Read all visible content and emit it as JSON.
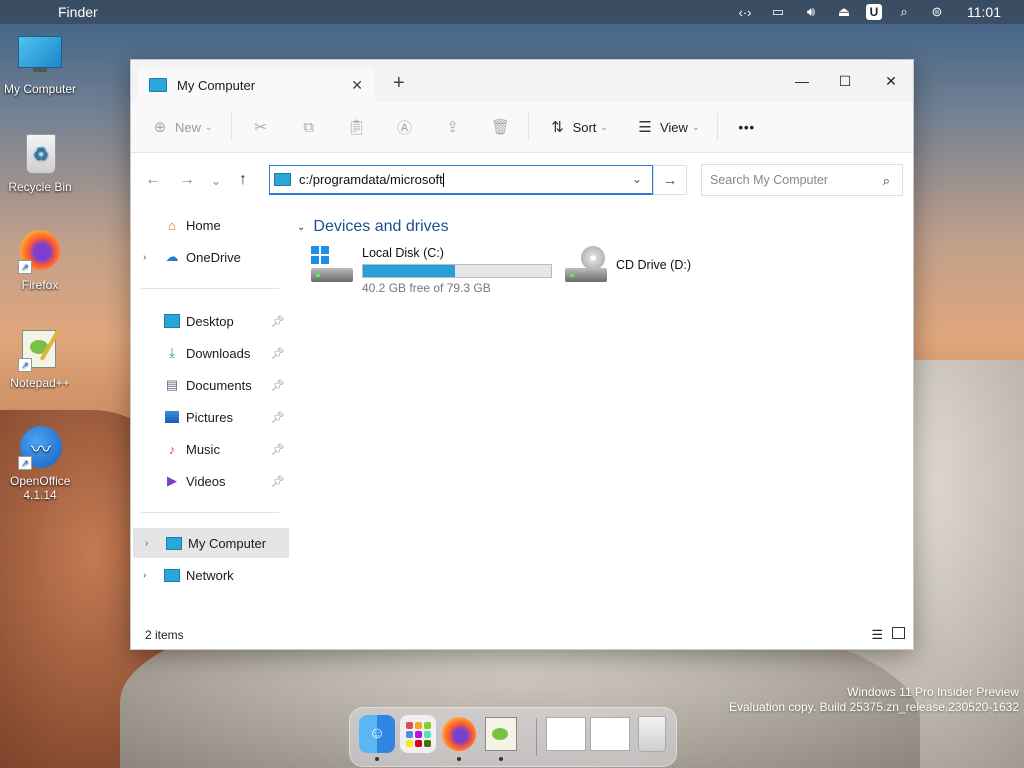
{
  "menubar": {
    "app_name": "Finder",
    "clock": "11:01",
    "user_badge": "U"
  },
  "desktop_icons": [
    {
      "label": "My Computer"
    },
    {
      "label": "Recycle Bin"
    },
    {
      "label": "Firefox"
    },
    {
      "label": "Notepad++"
    },
    {
      "label": "OpenOffice 4.1.14"
    }
  ],
  "window": {
    "tab_title": "My Computer",
    "toolbar": {
      "new": "New",
      "sort": "Sort",
      "view": "View",
      "more": "•••"
    },
    "address": "c:/programdata/microsoft",
    "search_placeholder": "Search My Computer",
    "sidebar": {
      "home": "Home",
      "onedrive": "OneDrive",
      "desktop": "Desktop",
      "downloads": "Downloads",
      "documents": "Documents",
      "pictures": "Pictures",
      "music": "Music",
      "videos": "Videos",
      "my_computer": "My Computer",
      "network": "Network"
    },
    "group_title": "Devices and drives",
    "drives": [
      {
        "name": "Local Disk (C:)",
        "free_text": "40.2 GB free of 79.3 GB",
        "used_fraction": 0.49
      },
      {
        "name": "CD Drive (D:)"
      }
    ],
    "status": {
      "count": "2 items"
    }
  },
  "watermark": {
    "line1": "Windows 11 Pro Insider Preview",
    "line2": "Evaluation copy. Build 25375.zn_release.230520-1632"
  },
  "colors": {
    "accent": "#2d7bd8",
    "drive_bar": "#26a0da"
  }
}
